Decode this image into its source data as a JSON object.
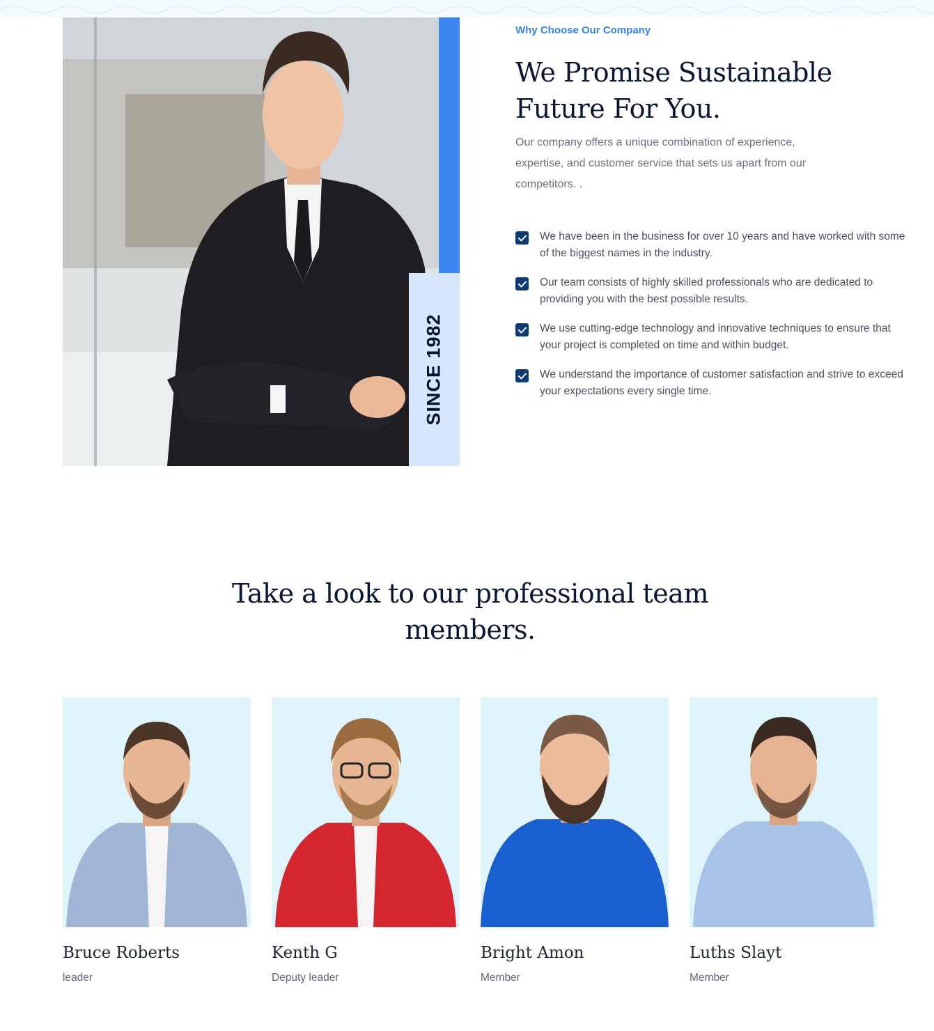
{
  "about": {
    "eyebrow": "Why Choose Our Company",
    "title": "We Promise Sustainable Future For You.",
    "description": "Our company offers a unique combination of experience, expertise, and customer service that sets us apart from our competitors. .",
    "badge": "SINCE 1982",
    "accent_color": "#3b86f0",
    "checklist": [
      "We have been in the business for over 10 years and have worked with some of the biggest names in the industry.",
      "Our team consists of highly skilled professionals who are dedicated to providing you with the best possible results.",
      "We use cutting-edge technology and innovative techniques to ensure that your project is completed on time and within budget.",
      "We understand the importance of customer satisfaction and strive to exceed your expectations every single time."
    ]
  },
  "team": {
    "title": "Take a look to our professional team members.",
    "members": [
      {
        "name": "Bruce Roberts",
        "role": "leader",
        "shirt_color": "#9fb6d6"
      },
      {
        "name": "Kenth G",
        "role": "Deputy leader",
        "shirt_color": "#d3262f"
      },
      {
        "name": "Bright Amon",
        "role": "Member",
        "shirt_color": "#1a5fd0"
      },
      {
        "name": "Luths Slayt",
        "role": "Member",
        "shirt_color": "#a9c3e8"
      }
    ]
  }
}
